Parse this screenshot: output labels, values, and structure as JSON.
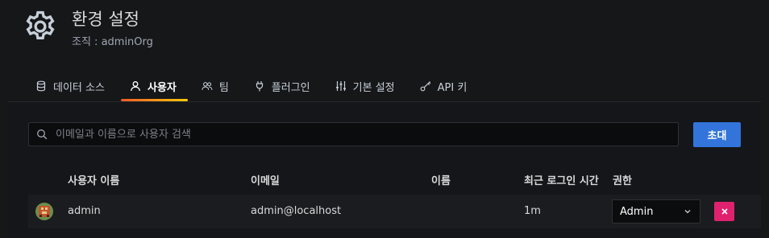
{
  "page": {
    "title": "환경 설정",
    "subtitle": "조직 : adminOrg",
    "icon": "gear-icon"
  },
  "tabs": [
    {
      "label": "데이터 소스",
      "icon": "database-icon",
      "active": false
    },
    {
      "label": "사용자",
      "icon": "user-icon",
      "active": true
    },
    {
      "label": "팀",
      "icon": "users-icon",
      "active": false
    },
    {
      "label": "플러그인",
      "icon": "plug-icon",
      "active": false
    },
    {
      "label": "기본 설정",
      "icon": "sliders-icon",
      "active": false
    },
    {
      "label": "API 키",
      "icon": "key-icon",
      "active": false
    }
  ],
  "search": {
    "placeholder": "이메일과 이름으로 사용자 검색",
    "value": ""
  },
  "invite_button": "초대",
  "table": {
    "headers": {
      "login": "사용자 이름",
      "email": "이메일",
      "name": "이름",
      "last_seen": "최근 로그인 시간",
      "role": "권한"
    },
    "rows": [
      {
        "login": "admin",
        "email": "admin@localhost",
        "name": "",
        "last_seen": "1m",
        "role": "Admin"
      }
    ]
  },
  "colors": {
    "accent": "#3274d9",
    "danger": "#e0226e",
    "tab_underline": "#f05a28"
  }
}
